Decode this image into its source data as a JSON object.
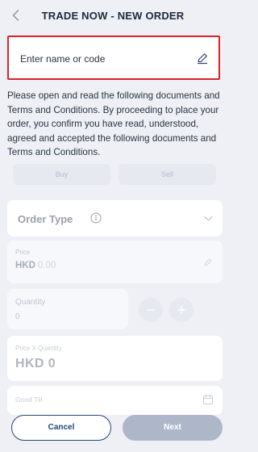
{
  "header": {
    "title": "TRADE NOW - NEW ORDER",
    "back_icon": "chevron-left-icon"
  },
  "search": {
    "placeholder": "Enter name or code",
    "edit_icon": "pencil-icon"
  },
  "terms_text": "Please open and read the following documents and Terms and Conditions. By proceeding to place your order, you confirm you have read, understood, agreed and accepted the following documents and Terms and Conditions.",
  "side": {
    "buy_label": "Buy",
    "sell_label": "Sell"
  },
  "order_type": {
    "label": "Order Type",
    "info_icon": "info-icon",
    "chevron_icon": "chevron-down-icon"
  },
  "price": {
    "label": "Price",
    "currency": "HKD",
    "value": "0.00"
  },
  "quantity": {
    "label": "Quantity",
    "value": "0",
    "minus": "−",
    "plus": "+"
  },
  "total": {
    "label": "Price X Quantity",
    "value": "HKD 0"
  },
  "good_till": {
    "label": "Good Till",
    "calendar_icon": "calendar-icon"
  },
  "actions": {
    "cancel_label": "Cancel",
    "next_label": "Next"
  },
  "colors": {
    "background": "#eef0f5",
    "highlight_border": "#d9232d",
    "primary": "#28457a",
    "disabled_button": "#aeb7c9"
  }
}
